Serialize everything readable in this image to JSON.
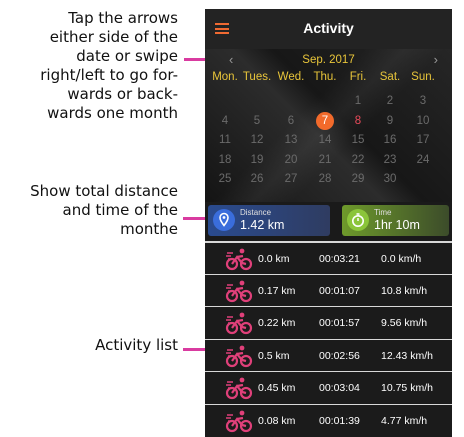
{
  "annotations": {
    "month_nav": [
      "Tap the arrows",
      "either side of the",
      "date or swipe",
      "right/left to go for-",
      "wards or back-",
      "wards one month"
    ],
    "totals": [
      "Show total distance",
      "and time of the",
      "monthe"
    ],
    "list": [
      "Activity list"
    ]
  },
  "app": {
    "title": "Activity",
    "menu_icon": "hamburger-menu-icon",
    "accent_color": "#f06a32"
  },
  "calendar": {
    "month_label": "Sep. 2017",
    "prev_icon": "chevron-left-icon",
    "next_icon": "chevron-right-icon",
    "weekdays": [
      "Mon.",
      "Tues.",
      "Wed.",
      "Thu.",
      "Fri.",
      "Sat.",
      "Sun."
    ],
    "weeks": [
      [
        "",
        "",
        "",
        "",
        "1",
        "2",
        "3"
      ],
      [
        "4",
        "5",
        "6",
        "7",
        "8",
        "9",
        "10"
      ],
      [
        "11",
        "12",
        "13",
        "14",
        "15",
        "16",
        "17"
      ],
      [
        "18",
        "19",
        "20",
        "21",
        "22",
        "23",
        "24"
      ],
      [
        "25",
        "26",
        "27",
        "28",
        "29",
        "30",
        ""
      ]
    ],
    "selected_day": "7",
    "highlighted_days": [
      "8"
    ]
  },
  "summary": {
    "distance_label": "Distance",
    "distance_value": "1.42 km",
    "distance_icon": "location-pin-icon",
    "time_label": "Time",
    "time_value": "1hr 10m",
    "time_icon": "stopwatch-icon"
  },
  "activities": [
    {
      "distance": "0.0 km",
      "duration": "00:03:21",
      "speed": "0.0 km/h"
    },
    {
      "distance": "0.17 km",
      "duration": "00:01:07",
      "speed": "10.8 km/h"
    },
    {
      "distance": "0.22 km",
      "duration": "00:01:57",
      "speed": "9.56 km/h"
    },
    {
      "distance": "0.5 km",
      "duration": "00:02:56",
      "speed": "12.43 km/h"
    },
    {
      "distance": "0.45 km",
      "duration": "00:03:04",
      "speed": "10.75 km/h"
    },
    {
      "distance": "0.08 km",
      "duration": "00:01:39",
      "speed": "4.77 km/h"
    }
  ]
}
